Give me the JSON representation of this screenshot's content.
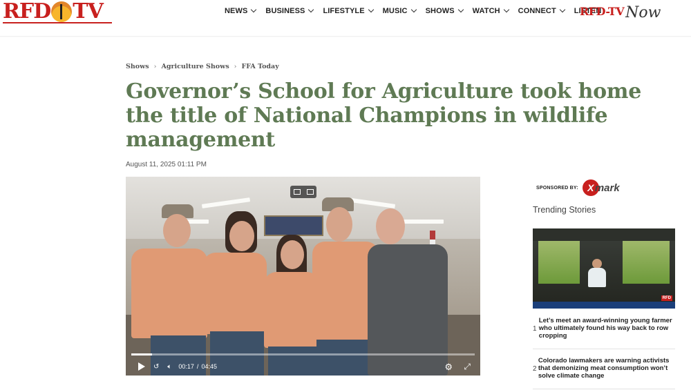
{
  "header": {
    "logo_text": "RFD-TV",
    "nav": [
      {
        "label": "NEWS",
        "dropdown": true
      },
      {
        "label": "BUSINESS",
        "dropdown": true
      },
      {
        "label": "LIFESTYLE",
        "dropdown": true
      },
      {
        "label": "MUSIC",
        "dropdown": true
      },
      {
        "label": "SHOWS",
        "dropdown": true
      },
      {
        "label": "WATCH",
        "dropdown": true
      },
      {
        "label": "CONNECT",
        "dropdown": true
      },
      {
        "label": "LISTEN",
        "dropdown": false
      }
    ],
    "now_logo": {
      "brand": "RFD-TV",
      "word": "Now"
    }
  },
  "article": {
    "breadcrumb": [
      "Shows",
      "Agriculture Shows",
      "FFA Today"
    ],
    "title": "Governor’s School for Agriculture took home the title of National Champions in wildlife management",
    "date": "August 11, 2025 01:11 PM"
  },
  "video": {
    "current_time": "00:17",
    "duration": "04:45",
    "progress_fraction": 0.06
  },
  "sidebar": {
    "sponsor_label": "SPONSORED BY:",
    "sponsor_name": "exmark",
    "trending_title": "Trending Stories",
    "stories": [
      {
        "num": "1",
        "text": "Let’s meet an award-winning young farmer who ultimately found his way back to row cropping"
      },
      {
        "num": "2",
        "text": "Colorado lawmakers are warning activists that demonizing meat consumption won’t solve climate change"
      }
    ]
  },
  "colors": {
    "brand_red": "#c8201e",
    "title_green": "#5f7a54"
  }
}
